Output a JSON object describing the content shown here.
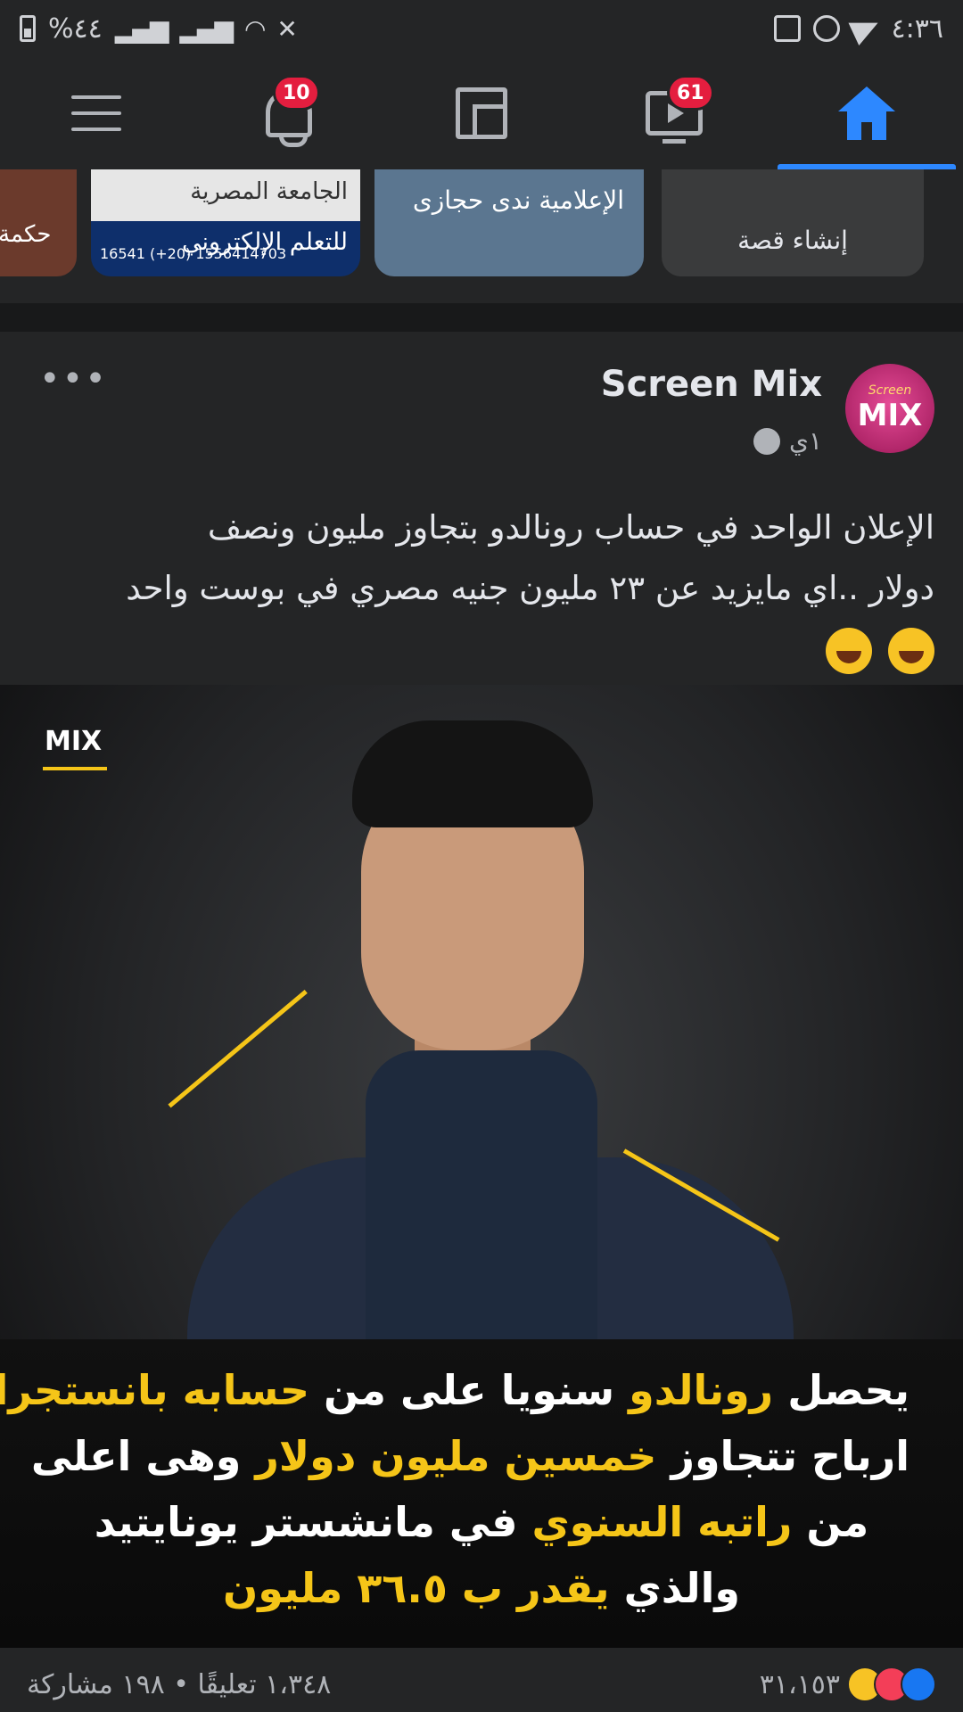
{
  "status_bar": {
    "battery": "%٤٤",
    "time": "٤:٣٦"
  },
  "nav": {
    "notifications_count": "10",
    "watch_count": "61",
    "active_tab": "home"
  },
  "stories": {
    "create_label": "إنشاء قصة",
    "story1_title": "الإعلامية ندى حجازى",
    "story2_title": "الجامعة المصرية",
    "story2_subtitle": "للتعلم الإلكتروني",
    "story2_phone": "16541 (+20) 1556414703",
    "story3_title": "حكمة"
  },
  "post": {
    "page_name": "Screen Mix",
    "avatar_text_top": "Screen",
    "avatar_text_main": "MIX",
    "time": "١ي",
    "text_line1": "الإعلان الواحد في حساب رونالدو بتجاوز مليون ونصف",
    "text_line2": "دولار ..اي مايزيد عن ٢٣ مليون جنيه مصري في بوست واحد",
    "image": {
      "logo": "MIX",
      "caption_line1_a": "يحصل",
      "caption_line1_b": "رونالدو",
      "caption_line1_c": "سنويا على من",
      "caption_line1_d": "حسابه بانستجرام",
      "caption_line2_a": "ارباح تتجاوز",
      "caption_line2_b": "خمسين مليون دولار",
      "caption_line2_c": "وهى اعلى",
      "caption_line3_a": "من",
      "caption_line3_b": "راتبه السنوي",
      "caption_line3_c": "في مانشستر يونايتيد",
      "caption_line4_a": "والذي",
      "caption_line4_b": "يقدر ب ٣٦.٥ مليون"
    },
    "reactions_count": "٣١،١٥٣",
    "comments_shares": "١،٣٤٨ تعليقًا • ١٩٨ مشاركة"
  },
  "colors": {
    "accent": "#2d88ff",
    "badge": "#e41e3f",
    "caption_yellow": "#f5c518",
    "background": "#242526"
  }
}
